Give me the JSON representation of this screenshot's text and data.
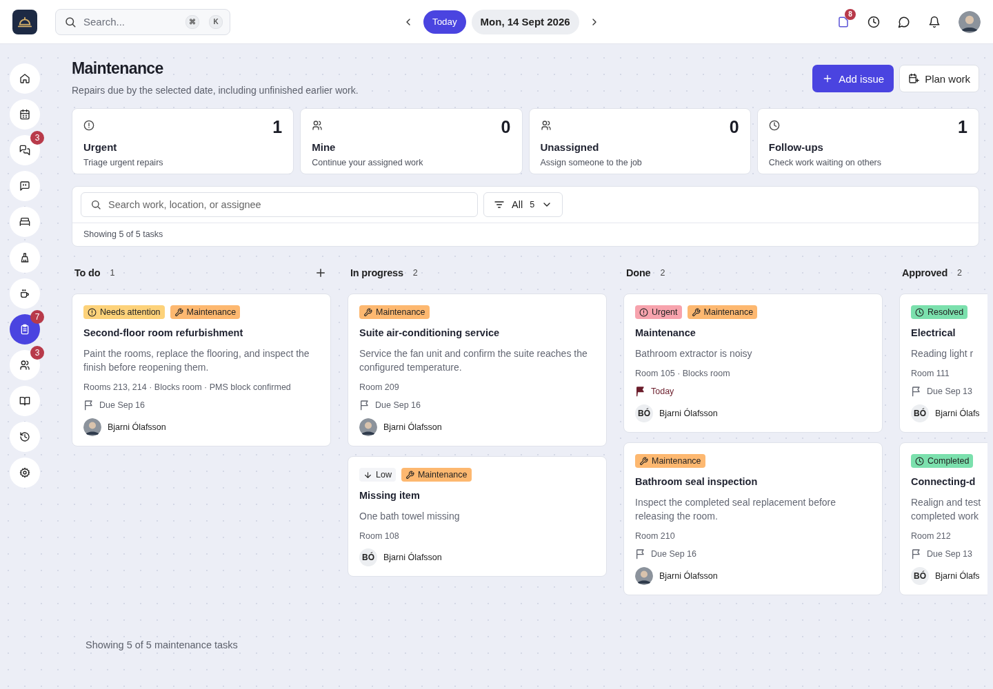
{
  "topbar": {
    "search": {
      "placeholder": "Search...",
      "keys": [
        "⌘",
        "K"
      ]
    },
    "today_button": "Today",
    "date": "Mon, 14 Sept 2026",
    "actions": [
      {
        "kind": "file",
        "badge": "8",
        "selected": true
      },
      {
        "kind": "clock",
        "selected": false
      },
      {
        "kind": "chat",
        "selected": false
      },
      {
        "kind": "bell",
        "selected": false
      }
    ]
  },
  "sidebar": {
    "items": [
      {
        "kind": "home",
        "selected": false
      },
      {
        "kind": "calendar",
        "selected": false
      },
      {
        "kind": "chats",
        "selected": false,
        "badge": "3"
      },
      {
        "kind": "quote",
        "selected": false
      },
      {
        "kind": "bed",
        "selected": false
      },
      {
        "kind": "broom",
        "selected": false
      },
      {
        "kind": "cup",
        "selected": false
      },
      {
        "kind": "clipboard",
        "selected": true,
        "badge": "7"
      },
      {
        "kind": "users",
        "selected": false,
        "badge": "3"
      },
      {
        "kind": "book",
        "selected": false
      },
      {
        "kind": "history",
        "selected": false
      },
      {
        "kind": "gear",
        "selected": false
      }
    ]
  },
  "header": {
    "title": "Maintenance",
    "subtitle": "Repairs due by the selected date, including unfinished earlier work.",
    "actions": [
      {
        "kind": "primary",
        "label": "Add issue"
      },
      {
        "kind": "secondary",
        "label": "Plan work"
      }
    ]
  },
  "stats": [
    {
      "kind": "alert",
      "count": "1",
      "title": "Urgent",
      "subtitle": "Triage urgent repairs"
    },
    {
      "kind": "users",
      "count": "0",
      "title": "Mine",
      "subtitle": "Continue your assigned work"
    },
    {
      "kind": "users",
      "count": "0",
      "title": "Unassigned",
      "subtitle": "Assign someone to the job"
    },
    {
      "kind": "clock",
      "count": "1",
      "title": "Follow-ups",
      "subtitle": "Check work waiting on others"
    }
  ],
  "filters": {
    "search": {
      "placeholder": "Search work, location, or assignee"
    },
    "filter": {
      "label": "All",
      "count": "5"
    },
    "summary": "Showing 5 of 5 tasks"
  },
  "columns": [
    {
      "title": "To do",
      "count": "1",
      "can_add": true,
      "cards": [
        {
          "badges": [
            {
              "kind": "attention",
              "label": "Needs attention"
            },
            {
              "kind": "category",
              "label": "Maintenance"
            }
          ],
          "title": "Second-floor room refurbishment",
          "description": "Paint the rooms, replace the flooring, and inspect the finish before reopening them.",
          "location": "Rooms 213, 214 · Blocks room · PMS block confirmed",
          "due": {
            "kind": "normal",
            "text": "Due Sep 16"
          },
          "assignee": {
            "kind": "photo",
            "name": "Bjarni Ólafsson"
          }
        }
      ]
    },
    {
      "title": "In progress",
      "count": "2",
      "cards": [
        {
          "badges": [
            {
              "kind": "category",
              "label": "Maintenance"
            }
          ],
          "title": "Suite air-conditioning service",
          "description": "Service the fan unit and confirm the suite reaches the configured temperature.",
          "location": "Room 209",
          "due": {
            "kind": "normal",
            "text": "Due Sep 16"
          },
          "assignee": {
            "kind": "photo",
            "name": "Bjarni Ólafsson"
          }
        },
        {
          "badges": [
            {
              "kind": "low",
              "label": "Low"
            },
            {
              "kind": "category",
              "label": "Maintenance"
            }
          ],
          "title": "Missing item",
          "description": "One bath towel missing",
          "location": "Room 108",
          "assignee": {
            "kind": "initials",
            "initials": "BÓ",
            "name": "Bjarni Ólafsson"
          }
        }
      ]
    },
    {
      "title": "Done",
      "count": "2",
      "cards": [
        {
          "badges": [
            {
              "kind": "urgent",
              "label": "Urgent"
            },
            {
              "kind": "category",
              "label": "Maintenance"
            }
          ],
          "title": "Maintenance",
          "description": "Bathroom extractor is noisy",
          "location": "Room 105 · Blocks room",
          "due": {
            "kind": "today",
            "text": "Today"
          },
          "assignee": {
            "kind": "initials",
            "initials": "BÓ",
            "name": "Bjarni Ólafsson"
          }
        },
        {
          "badges": [
            {
              "kind": "category",
              "label": "Maintenance"
            }
          ],
          "title": "Bathroom seal inspection",
          "description": "Inspect the completed seal replacement before releasing the room.",
          "location": "Room 210",
          "due": {
            "kind": "normal",
            "text": "Due Sep 16"
          },
          "assignee": {
            "kind": "photo",
            "name": "Bjarni Ólafsson"
          }
        }
      ]
    },
    {
      "title": "Approved",
      "count": "2",
      "cards": [
        {
          "badges": [
            {
              "kind": "resolved",
              "label": "Resolved"
            }
          ],
          "title": "Electrical",
          "description": "Reading light r",
          "location": "Room 111",
          "due": {
            "kind": "normal",
            "text": "Due Sep 13"
          },
          "assignee": {
            "kind": "initials",
            "initials": "BÓ",
            "name": "Bjarni Ólafs"
          }
        },
        {
          "badges": [
            {
              "kind": "resolved",
              "label": "Completed"
            }
          ],
          "title": "Connecting-d",
          "description": "Realign and test completed work",
          "location": "Room 212",
          "due": {
            "kind": "normal",
            "text": "Due Sep 13"
          },
          "assignee": {
            "kind": "initials",
            "initials": "BÓ",
            "name": "Bjarni Ólafs"
          }
        }
      ]
    }
  ],
  "footer": "Showing 5 of 5 maintenance tasks"
}
